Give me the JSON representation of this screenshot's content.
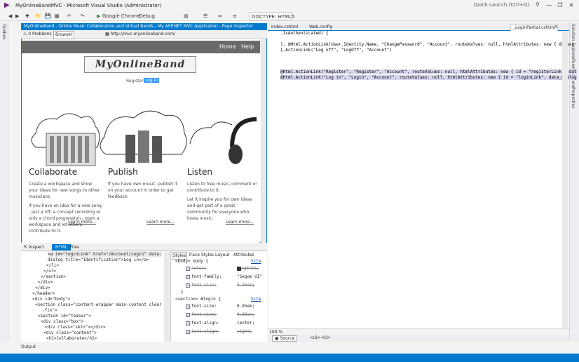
{
  "window": {
    "title": "MyOnlineBandMVC - Microsoft Visual Studio (Administrator)",
    "quick_launch": "Quick Launch (Ctrl+Q)"
  },
  "toolbar": {
    "browser": "Google Chrome",
    "config": "Debug",
    "doctype": "DOCTYPE: HTML5"
  },
  "side_panels": {
    "toolbox": "Toolbox",
    "solution_explorer": "Solution Explorer",
    "team_explorer": "Team Explorer",
    "properties": "Properties"
  },
  "page_inspector": {
    "title": "MyOnlineBand - Online Music Collaboration and Virtual Bands - My ASP.NET MVC Application - Page Inspector",
    "problems": "0 Problems",
    "browser_button": "Browser",
    "url": "http://mvc.myonlineband.com/"
  },
  "site": {
    "nav": [
      "Home",
      "Help"
    ],
    "logo": "MyOnlineBand",
    "register": "Register",
    "login": "Log in",
    "features": [
      {
        "title": "Collaborate",
        "paragraphs": [
          "Create a workspace and show your ideas for new songs to other musicians.",
          "If you have an idea for a new song - just a riff, a concept recording or only a chord progression - open a workspace and let others contribute to it."
        ],
        "learn_more": "Learn more..."
      },
      {
        "title": "Publish",
        "paragraphs": [
          "If you have own music, publish it on your account in order to get feedback."
        ],
        "learn_more": "Learn more..."
      },
      {
        "title": "Listen",
        "paragraphs": [
          "Listen to free music, comment or contribute to it.",
          "Let it inspire you for own ideas and get part of a great community for everyone who loves music."
        ],
        "learn_more": "Learn more..."
      }
    ]
  },
  "inspector_tabs": {
    "inspect": "Inspect",
    "html": "HTML",
    "files": "Files"
  },
  "dom_lines": [
    "<a id=\"loginLink\" href=\"/Account/Login\" data-",
    "dialog-title=\"Identification\">Log in</a>",
    "</li>",
    "</ul>",
    "</section>",
    "</div>",
    "</div>",
    "</header>",
    "<div id=\"body\">",
    "<section class=\"content-wrapper main-content clear",
    "-fix\">",
    "<section id=\"teaser\">",
    "<div class=\"box\">",
    "<div class=\"skin\"></div>",
    "<div class=\"content\">",
    "<h2>Collaborate</h2>"
  ],
  "styles_tabs": [
    "Styles",
    "Trace Styles",
    "Layout",
    "Attributes"
  ],
  "styles": {
    "rule1": "<body> body {",
    "rule1_src": "Site",
    "props1": [
      {
        "name": "color:",
        "value": "rgb(51,",
        "struck": true
      },
      {
        "name": "font-family:",
        "value": "\"Segoe UI\"",
        "struck": false
      },
      {
        "name": "font-size:",
        "value": "0.85em;",
        "struck": true
      }
    ],
    "rule2": "<section> #login {",
    "rule2_src": "Site",
    "props2": [
      {
        "name": "font-size:",
        "value": "0.85em;",
        "struck": false
      },
      {
        "name": "font-size:",
        "value": "0.85em;",
        "struck": true
      },
      {
        "name": "text-align:",
        "value": "center;",
        "struck": false
      },
      {
        "name": "text-align:",
        "value": "right;",
        "struck": true
      }
    ]
  },
  "editor": {
    "tabs": [
      "Index.cshtml",
      "Web.config",
      "_LoginPartial.cshtml"
    ],
    "lines": [
      ".IsAuthenticated) {",
      "), @Html.ActionLink(User.Identity.Name, \"ChangePassword\", \"Account\", routeValues: null, htmlAttributes: new { @class",
      "[.ActionLink(\"Log off\", \"LogOff\", \"Account\")",
      "@Html.ActionLink(\"Register\", \"Register\", \"Account\", routeValues: null, htmlAttributes: new { id = \"registerLink\", dat",
      "@Html.ActionLink(\"Log in\", \"Login\", \"Account\", routeValues: null, htmlAttributes: new { id = \"loginLink\", data_dialog"
    ],
    "zoom": "100 %",
    "source_button": "Source",
    "breadcrumb": [
      "<ul>",
      "<li>"
    ]
  },
  "output_label": "Output",
  "colors": {
    "accent": "#007acc",
    "nav_bg": "#6a6a6a",
    "login_highlight": "#3399ff"
  }
}
